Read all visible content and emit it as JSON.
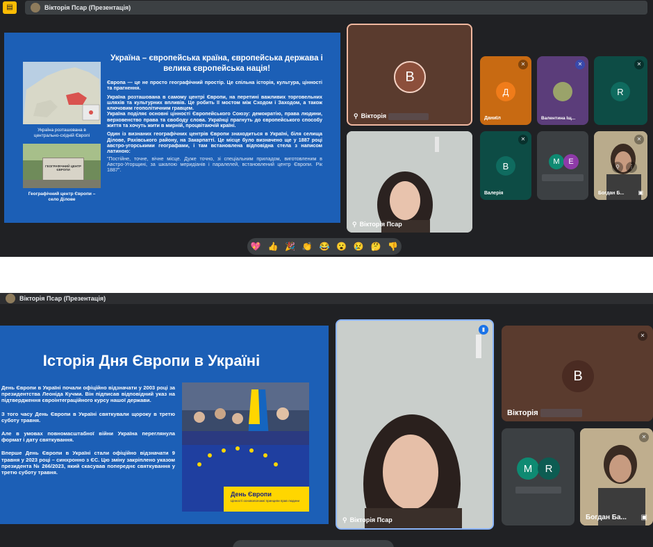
{
  "shot1": {
    "presenter_label": "Вікторія Псар (Презентація)",
    "slide": {
      "title": "Україна – європейська країна, європейська держава і велика європейська нація!",
      "paragraphs": [
        "Європа — це не просто географічний простір. Це спільна історія, культура, цінності та прагнення.",
        "Україна розташована в самому центрі Європи, на перетині важливих торговельних шляхів та культурних впливів. Це робить її мостом між Сходом і Заходом, а також ключовим геополітичним гравцем.",
        "Україна поділяє основні цінності Європейського Союзу: демократію, права людини, верховенство права та свободу слова. Українці прагнуть до європейського способу життя та хочуть жити в мирній, процвітаючій країні.",
        "Один із визнаних географічних центрів Європи знаходиться в Україні, біля селища Ділове, Рахівського району, на Закарпатті. Це місце було визначено ще у 1887 році австро-угорськими географами, і там встановлена відповідна стела з написом латиною:"
      ],
      "quote": "\"Постійне, точне, вічне місце. Дуже точно, зі спеціальним приладом, виготовленим в Австро-Угорщині, за шкалою меридіанів і паралелей, встановлений центр Європи. Рік 1887\".",
      "map_caption": "Україна розташована в центрально-східній Європі",
      "photo_caption": "Географічний центр Європи – село Ділове",
      "sign_text": "ГЕОГРАФІЧНИЙ ЦЕНТР ЄВРОПИ"
    },
    "tiles": {
      "victoria_large": {
        "initial": "В",
        "name": "Вікторія"
      },
      "victoria_cam": {
        "name": "Вікторія Псар"
      },
      "daniil": {
        "initial": "Д",
        "name": "Даниїл"
      },
      "valentina": {
        "name": "Валентина Іщ..."
      },
      "r": {
        "initial": "R"
      },
      "valeria": {
        "initial": "В",
        "name": "Валерія"
      },
      "group_m": "M",
      "group_e": "E",
      "bohdan": {
        "name": "Богдан Б..."
      }
    },
    "reactions": [
      "💖",
      "👍",
      "🎉",
      "👏",
      "😂",
      "😮",
      "😢",
      "🤔",
      "👎"
    ]
  },
  "shot2": {
    "presenter_label": "Вікторія Псар (Презентація)",
    "slide": {
      "title": "Історія Дня Європи в Україні",
      "paragraphs": [
        "День Європи в Україні почали офіційно відзначати у 2003 році за президентства Леоніда Кучми. Він підписав відповідний указ на підтвердження євроінтеграційного курсу нашої держави.",
        "З того часу День Європи в Україні святкували щороку в третю суботу травня.",
        "Але в умовах повномасштабної війни Україна переглянула формат і дату святкування.",
        "Вперше День Європи в Україні стали офіційно відзначати 9 травня у 2023 році – синхронно з ЄС. Цю зміну закріплено указом президента № 266/2023, який скасував попереднє святкування у третю суботу травня."
      ],
      "banner_title": "День Європи",
      "banner_sub": "Цінності основоположні принципи прав людини"
    },
    "tiles": {
      "victoria_cam": {
        "name": "Вікторія Псар"
      },
      "victoria_avatar": {
        "initial": "В",
        "name": "Вікторія"
      },
      "group_m": "M",
      "group_r": "R",
      "bohdan": {
        "name": "Богдан Ба..."
      }
    }
  },
  "colors": {
    "meet_bg": "#202124",
    "tile_bg": "#3c4043",
    "slide_blue": "#1c5fb6",
    "accent_yellow": "#fbbc04"
  }
}
